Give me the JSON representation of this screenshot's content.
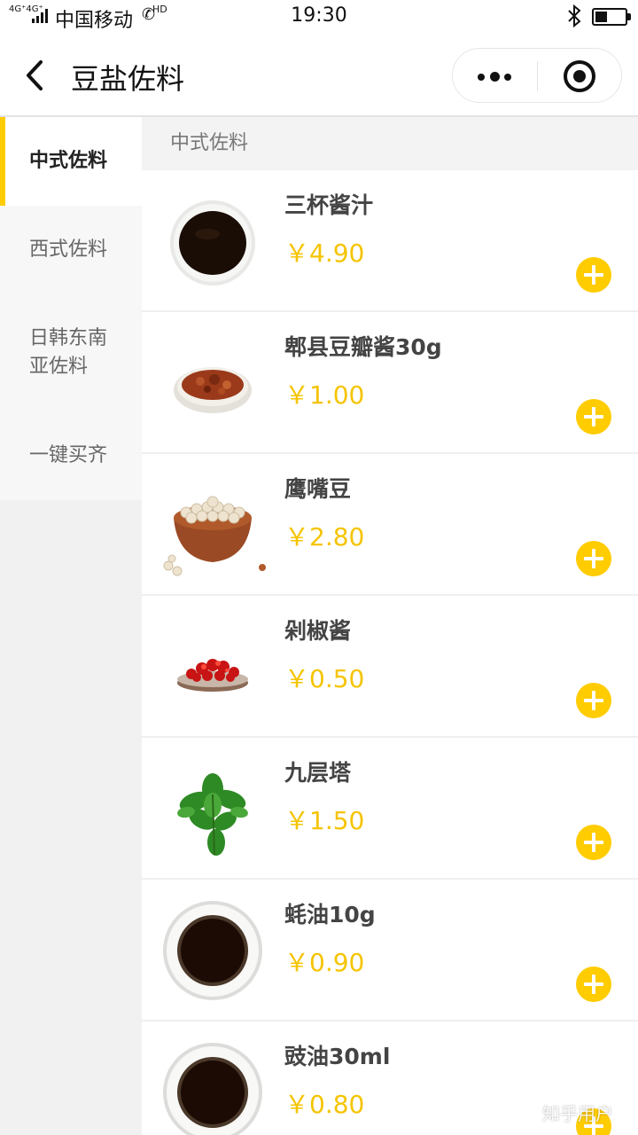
{
  "status_bar": {
    "network": "4G⁺4G⁺",
    "carrier": "中国移动",
    "hd": "HD",
    "time": "19:30",
    "battery_level": 0.4
  },
  "nav": {
    "title": "豆盐佐料",
    "back_icon": "chevron-left-icon",
    "more_icon": "more-dots-icon",
    "close_icon": "target-close-icon"
  },
  "sidebar": {
    "items": [
      {
        "label": "中式佐料",
        "active": true
      },
      {
        "label": "西式佐料",
        "active": false
      },
      {
        "label": "日韩东南亚佐料",
        "active": false
      },
      {
        "label": "一键买齐",
        "active": false
      }
    ]
  },
  "content": {
    "section_title": "中式佐料",
    "products": [
      {
        "name": "三杯酱汁",
        "price": "￥4.90",
        "image": "dark-sauce-dish"
      },
      {
        "name": "郫县豆瓣酱30g",
        "price": "￥1.00",
        "image": "bean-paste-dish"
      },
      {
        "name": "鹰嘴豆",
        "price": "￥2.80",
        "image": "chickpea-bowl"
      },
      {
        "name": "剁椒酱",
        "price": "￥0.50",
        "image": "chopped-chili-dish"
      },
      {
        "name": "九层塔",
        "price": "￥1.50",
        "image": "basil-leaves"
      },
      {
        "name": "蚝油10g",
        "price": "￥0.90",
        "image": "dark-sauce-dish"
      },
      {
        "name": "豉油30ml",
        "price": "￥0.80",
        "image": "dark-sauce-dish"
      }
    ]
  },
  "watermark": "知乎用户",
  "colors": {
    "accent": "#ffcc00",
    "price": "#f5c400",
    "sidebar_bg": "#f7f7f7"
  }
}
